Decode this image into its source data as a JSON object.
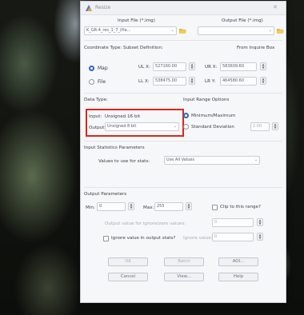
{
  "window": {
    "title": "Resize"
  },
  "files": {
    "input_label": "Input File (*.img)",
    "output_label": "Output File (*.img)",
    "input_value": "K_GR-4_res_1_7_(Ha...",
    "output_value": ""
  },
  "subset": {
    "label": "Coordinate Type:   Subset Definition:",
    "from_inquire": "From Inquire Box",
    "map_label": "Map",
    "file_label": "File",
    "ulx_label": "UL X:",
    "ulx_value": "527160.00",
    "uly_label": "UR X:",
    "uly_value": "583609.60",
    "lrx_label": "LL X:",
    "lrx_value": "538475.00",
    "lry_label": "LR Y:",
    "lry_value": "464580.60"
  },
  "data_type": {
    "section": "Data Type:",
    "input_label": "Input:",
    "input_value": "Unsigned 16 bit",
    "output_label": "Output:",
    "output_value": "Unsigned 8 bit"
  },
  "range": {
    "section": "Input Range Options",
    "minmax_label": "Minimum/Maximum",
    "stddev_label": "Standard Deviation",
    "stddev_value": "2.00"
  },
  "stats": {
    "section": "Input Statistics Parameters",
    "values_label": "Values to use for stats:",
    "values_value": "Use All Values"
  },
  "output_params": {
    "section": "Output Parameters",
    "min_label": "Min:",
    "min_value": "0",
    "max_label": "Max:",
    "max_value": "255",
    "clip_label": "Clip to this range?",
    "output_value_label": "Output value for ignore/zero values:",
    "output_value": "0",
    "ignore_label": "Ignore value in output stats?",
    "ignore_value_label": "Ignore value:",
    "ignore_value": "0"
  },
  "buttons": {
    "ok": "OK",
    "batch": "Batch",
    "aoi": "AOI...",
    "cancel": "Cancel",
    "view": "View...",
    "help": "Help"
  },
  "colors": {
    "highlight": "#e2231a",
    "accent": "#2a67c9"
  }
}
